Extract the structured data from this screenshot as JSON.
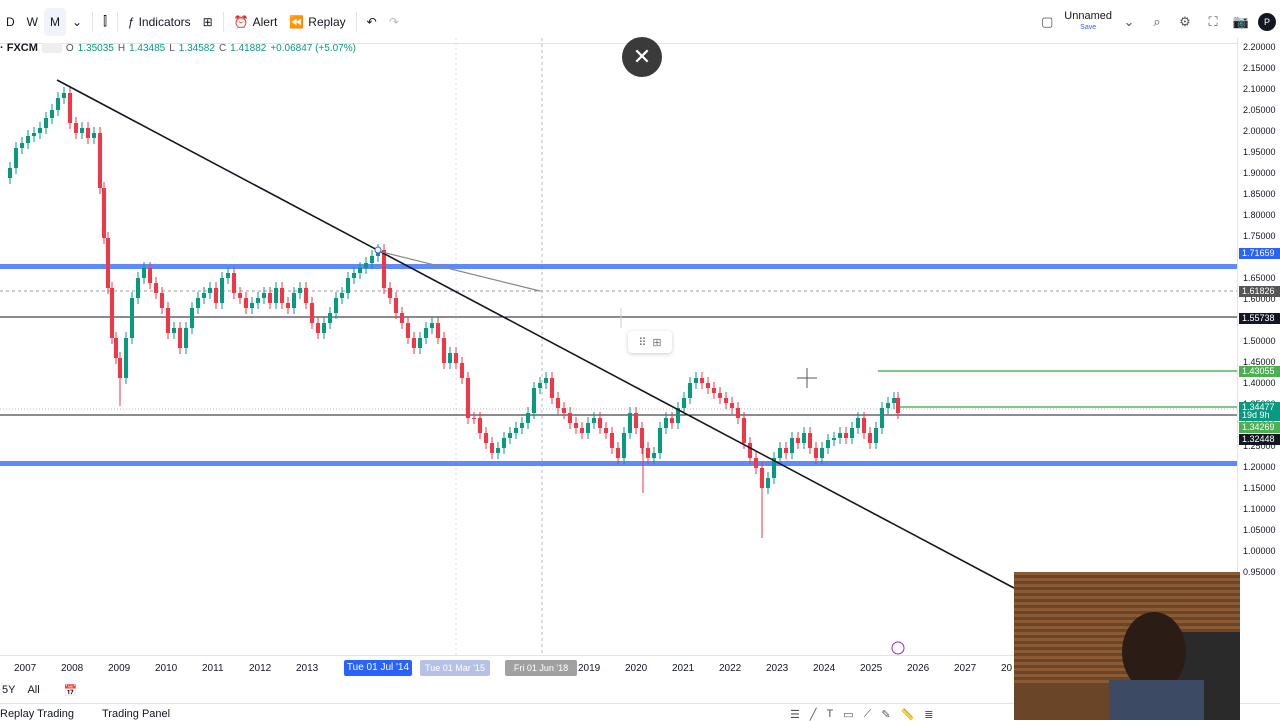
{
  "toolbar": {
    "intervals": [
      "D",
      "W",
      "M"
    ],
    "active_interval": "M",
    "indicators_label": "Indicators",
    "alert_label": "Alert",
    "replay_label": "Replay",
    "layout_name": "Unnamed",
    "layout_sub": "Save",
    "avatar_letter": "P"
  },
  "legend": {
    "symbol": "· FXCM",
    "open_label": "O",
    "open": "1.35035",
    "high_label": "H",
    "high": "1.43485",
    "low_label": "L",
    "low": "1.34582",
    "close_label": "C",
    "close": "1.41882",
    "change": "+0.06847 (+5.07%)"
  },
  "price_scale": {
    "ticks": [
      "2.20000",
      "2.15000",
      "2.10000",
      "2.05000",
      "2.00000",
      "1.95000",
      "1.90000",
      "1.85000",
      "1.80000",
      "1.75000",
      "1.65000",
      "1.60000",
      "1.50000",
      "1.45000",
      "1.40000",
      "1.35000",
      "1.30000",
      "1.25000",
      "1.20000",
      "1.15000",
      "1.10000",
      "1.05000",
      "1.00000",
      "0.95000"
    ],
    "badges": [
      {
        "text": "1.71659",
        "color": "#2962ff"
      },
      {
        "text": "1.61826",
        "color": "#555555"
      },
      {
        "text": "1.55738",
        "color": "#131722"
      },
      {
        "text": "1.43055",
        "color": "#4caf50"
      },
      {
        "text": "1.34477",
        "color": "#089981"
      },
      {
        "text": "19d 9h",
        "color": "#089981"
      },
      {
        "text": "1.34269",
        "color": "#4caf50"
      },
      {
        "text": "1.32448",
        "color": "#131722"
      }
    ]
  },
  "time_axis": {
    "years": [
      "2007",
      "2008",
      "2009",
      "2010",
      "2011",
      "2012",
      "2013",
      "2016",
      "2019",
      "2020",
      "2021",
      "2022",
      "2023",
      "2024",
      "2025",
      "2026",
      "2027",
      "20"
    ],
    "cursor_date": "Tue 01 Jul '14",
    "ghost_dates": [
      "Tue 01 Mar '15",
      "Fri 01 Jun '18"
    ]
  },
  "bottom_bar": {
    "range_5y": "5Y",
    "range_all": "All"
  },
  "panel_tabs": [
    "Replay Trading",
    "Trading Panel"
  ],
  "colors": {
    "up": "#089981",
    "down": "#f23645",
    "support_blue": "#2962ff",
    "green_line": "#4caf50"
  }
}
